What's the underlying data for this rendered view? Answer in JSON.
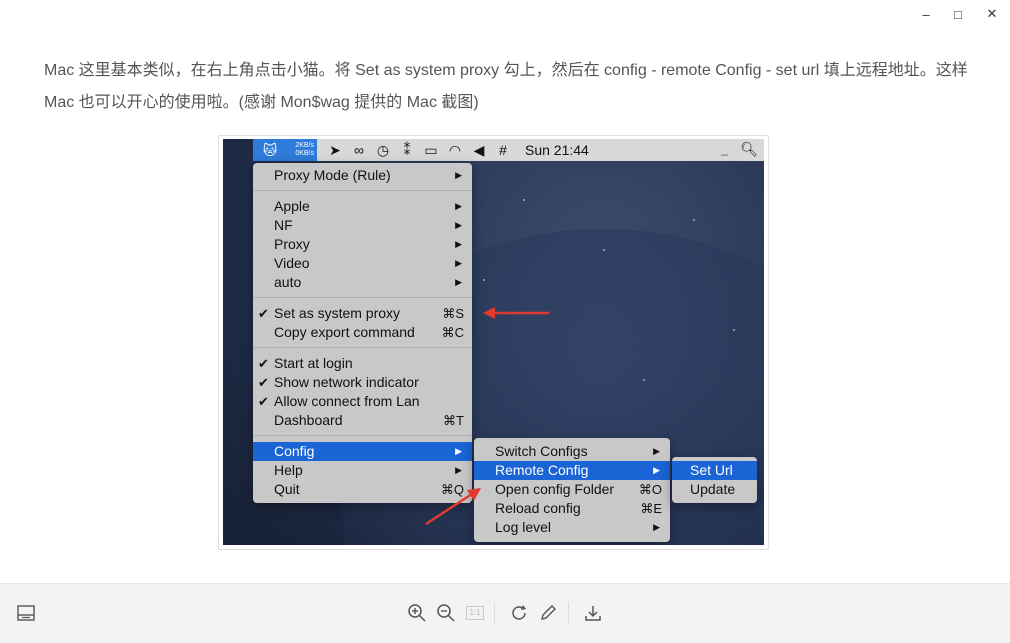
{
  "window": {
    "controls": {
      "minimize": "–",
      "maximize": "□",
      "close": "✕"
    }
  },
  "content": {
    "paragraph": "Mac 这里基本类似，在右上角点击小猫。将 Set as system proxy 勾上，然后在 config - remote Config - set url 填上远程地址。这样 Mac 也可以开心的使用啦。(感谢 Mon$wag 提供的 Mac 截图)"
  },
  "screenshot": {
    "menubar": {
      "speed_up": "2KB/s",
      "speed_down": "0KB/s",
      "clock": "Sun 21:44"
    },
    "main_menu": [
      {
        "label": "Proxy Mode (Rule)",
        "check": "",
        "shortcut": "",
        "arrow": "▶"
      },
      {
        "label": "Apple",
        "check": "",
        "shortcut": "",
        "arrow": "▶"
      },
      {
        "label": "NF",
        "check": "",
        "shortcut": "",
        "arrow": "▶"
      },
      {
        "label": "Proxy",
        "check": "",
        "shortcut": "",
        "arrow": "▶"
      },
      {
        "label": "Video",
        "check": "",
        "shortcut": "",
        "arrow": "▶"
      },
      {
        "label": "auto",
        "check": "",
        "shortcut": "",
        "arrow": "▶"
      },
      {
        "label": "Set as system proxy",
        "check": "✔",
        "shortcut": "⌘S",
        "arrow": ""
      },
      {
        "label": "Copy export command",
        "check": "",
        "shortcut": "⌘C",
        "arrow": ""
      },
      {
        "label": "Start at login",
        "check": "✔",
        "shortcut": "",
        "arrow": ""
      },
      {
        "label": "Show network indicator",
        "check": "✔",
        "shortcut": "",
        "arrow": ""
      },
      {
        "label": "Allow connect from Lan",
        "check": "✔",
        "shortcut": "",
        "arrow": ""
      },
      {
        "label": "Dashboard",
        "check": "",
        "shortcut": "⌘T",
        "arrow": ""
      },
      {
        "label": "Config",
        "check": "",
        "shortcut": "",
        "arrow": "▶"
      },
      {
        "label": "Help",
        "check": "",
        "shortcut": "",
        "arrow": "▶"
      },
      {
        "label": "Quit",
        "check": "",
        "shortcut": "⌘Q",
        "arrow": ""
      }
    ],
    "config_menu": [
      {
        "label": "Switch Configs",
        "shortcut": "",
        "arrow": "▶"
      },
      {
        "label": "Remote Config",
        "shortcut": "",
        "arrow": "▶"
      },
      {
        "label": "Open config Folder",
        "shortcut": "⌘O",
        "arrow": ""
      },
      {
        "label": "Reload config",
        "shortcut": "⌘E",
        "arrow": ""
      },
      {
        "label": "Log level",
        "shortcut": "",
        "arrow": "▶"
      }
    ],
    "remote_menu": [
      {
        "label": "Set Url"
      },
      {
        "label": "Update"
      }
    ],
    "colors": {
      "menu_selection": "#1a64d6",
      "annotation_arrow": "#e23a2e"
    }
  },
  "toolbar": {
    "icons": [
      "layout-icon",
      "zoom-in-icon",
      "zoom-out-icon",
      "actual-size-icon",
      "rotate-icon",
      "edit-icon",
      "download-icon"
    ],
    "actual_size_label": "1:1"
  }
}
